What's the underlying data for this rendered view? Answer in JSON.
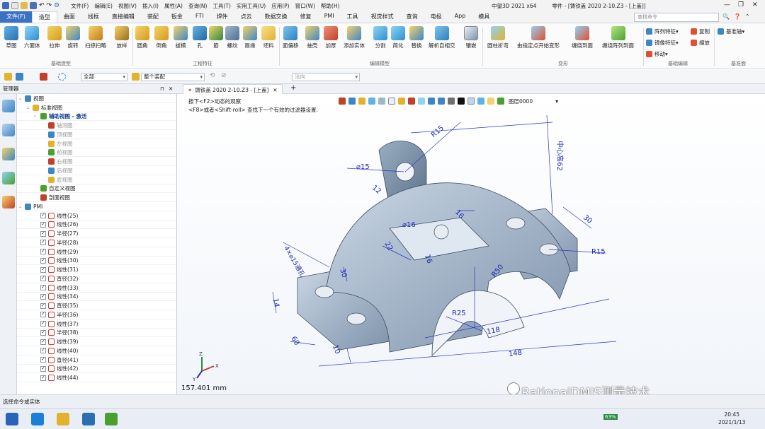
{
  "titlebar": {
    "menus": [
      "文件(F)",
      "编辑(E)",
      "视图(V)",
      "插入(I)",
      "属性(A)",
      "查询(N)",
      "工具(T)",
      "实用工具(U)",
      "应用(P)",
      "窗口(W)",
      "帮助(H)"
    ],
    "app_title": "中望3D 2021 x64",
    "doc_title": "零件 - [铸铁盖 2020 2-10.Z3 - [上盖]]"
  },
  "tabs": [
    "文件(F)",
    "造型",
    "曲面",
    "线框",
    "直接编辑",
    "装配",
    "钣金",
    "FTI",
    "焊件",
    "点云",
    "数据交换",
    "修复",
    "PMI",
    "工具",
    "视觉样式",
    "查询",
    "电极",
    "App",
    "模具"
  ],
  "search_placeholder": "查找命令",
  "ribbon": {
    "buttons": [
      "草图",
      "六面体",
      "拉伸",
      "旋转",
      "扫掠",
      "扫略",
      "放样",
      "圆角",
      "倒角",
      "拔模",
      "孔",
      "筋",
      "螺纹",
      "唇缘",
      "坯料",
      "面偏移",
      "抽壳",
      "加厚",
      "添加实体",
      "分割",
      "简化",
      "替换",
      "解析自相交",
      "镶嵌",
      "圆柱折弯",
      "由指定点开始变形",
      "缠绕到面",
      "缠绕阵列到面"
    ],
    "side_buttons": [
      "阵列特征",
      "镜像特征",
      "移动",
      "复制",
      "缩放",
      "基准轴"
    ],
    "groups": [
      "基础造型",
      "工程特征",
      "编辑模型",
      "变形",
      "基础编辑",
      "基准面"
    ]
  },
  "quickbar": {
    "filter": "全部",
    "assembly": "整个装配",
    "method": "法向"
  },
  "manager": {
    "title": "管理器"
  },
  "tree": [
    {
      "label": "视图",
      "level": 0
    },
    {
      "label": "标准视图",
      "level": 1
    },
    {
      "label": "辅助视图 - 激活",
      "level": 2,
      "sel": true
    },
    {
      "label": "轴测图",
      "level": 3,
      "dim": true
    },
    {
      "label": "顶视图",
      "level": 3,
      "dim": true
    },
    {
      "label": "左视图",
      "level": 3,
      "dim": true
    },
    {
      "label": "前视图",
      "level": 3,
      "dim": true
    },
    {
      "label": "右视图",
      "level": 3,
      "dim": true
    },
    {
      "label": "后视图",
      "level": 3,
      "dim": true
    },
    {
      "label": "底视图",
      "level": 3,
      "dim": true
    },
    {
      "label": "自定义视图",
      "level": 2
    },
    {
      "label": "剖面视图",
      "level": 2
    },
    {
      "label": "PMI",
      "level": 0
    },
    {
      "label": "线性(25)",
      "level": 2,
      "chk": true
    },
    {
      "label": "线性(26)",
      "level": 2,
      "chk": true
    },
    {
      "label": "半径(27)",
      "level": 2,
      "chk": true
    },
    {
      "label": "半径(28)",
      "level": 2,
      "chk": true
    },
    {
      "label": "线性(29)",
      "level": 2,
      "chk": true
    },
    {
      "label": "线性(30)",
      "level": 2,
      "chk": true
    },
    {
      "label": "线性(31)",
      "level": 2,
      "chk": true
    },
    {
      "label": "直径(32)",
      "level": 2,
      "chk": true
    },
    {
      "label": "线性(33)",
      "level": 2,
      "chk": true
    },
    {
      "label": "线性(34)",
      "level": 2,
      "chk": true
    },
    {
      "label": "直径(35)",
      "level": 2,
      "chk": true
    },
    {
      "label": "半径(36)",
      "level": 2,
      "chk": true
    },
    {
      "label": "线性(37)",
      "level": 2,
      "chk": true
    },
    {
      "label": "半径(38)",
      "level": 2,
      "chk": true
    },
    {
      "label": "线性(39)",
      "level": 2,
      "chk": true
    },
    {
      "label": "线性(40)",
      "level": 2,
      "chk": true
    },
    {
      "label": "直径(41)",
      "level": 2,
      "chk": true
    },
    {
      "label": "线性(42)",
      "level": 2,
      "chk": true
    },
    {
      "label": "线性(44)",
      "level": 2,
      "chk": true
    }
  ],
  "doc_tab": "铸铁盖 2020 2-10.Z3 - [上盖]",
  "hints": [
    "按下<F2>动态的观察",
    "<F8>或者<Shift-roll> 查找下一个有效的过滤器设置."
  ],
  "layer": "图层0000",
  "dimensions": [
    "R15",
    "⌀15",
    "中心高62",
    "12",
    "16",
    "⌀16",
    "30",
    "22",
    "16",
    "R15",
    "4×⌀15通孔",
    "30",
    "R50",
    "14",
    "R25",
    "118",
    "60",
    "10",
    "148"
  ],
  "scale_readout": "157.401 mm",
  "watermark": "RationalDMIS测量技术",
  "status": "选择命令或实体",
  "clock": {
    "time": "20:45",
    "date": "2021/1/13"
  },
  "tray": "63%"
}
